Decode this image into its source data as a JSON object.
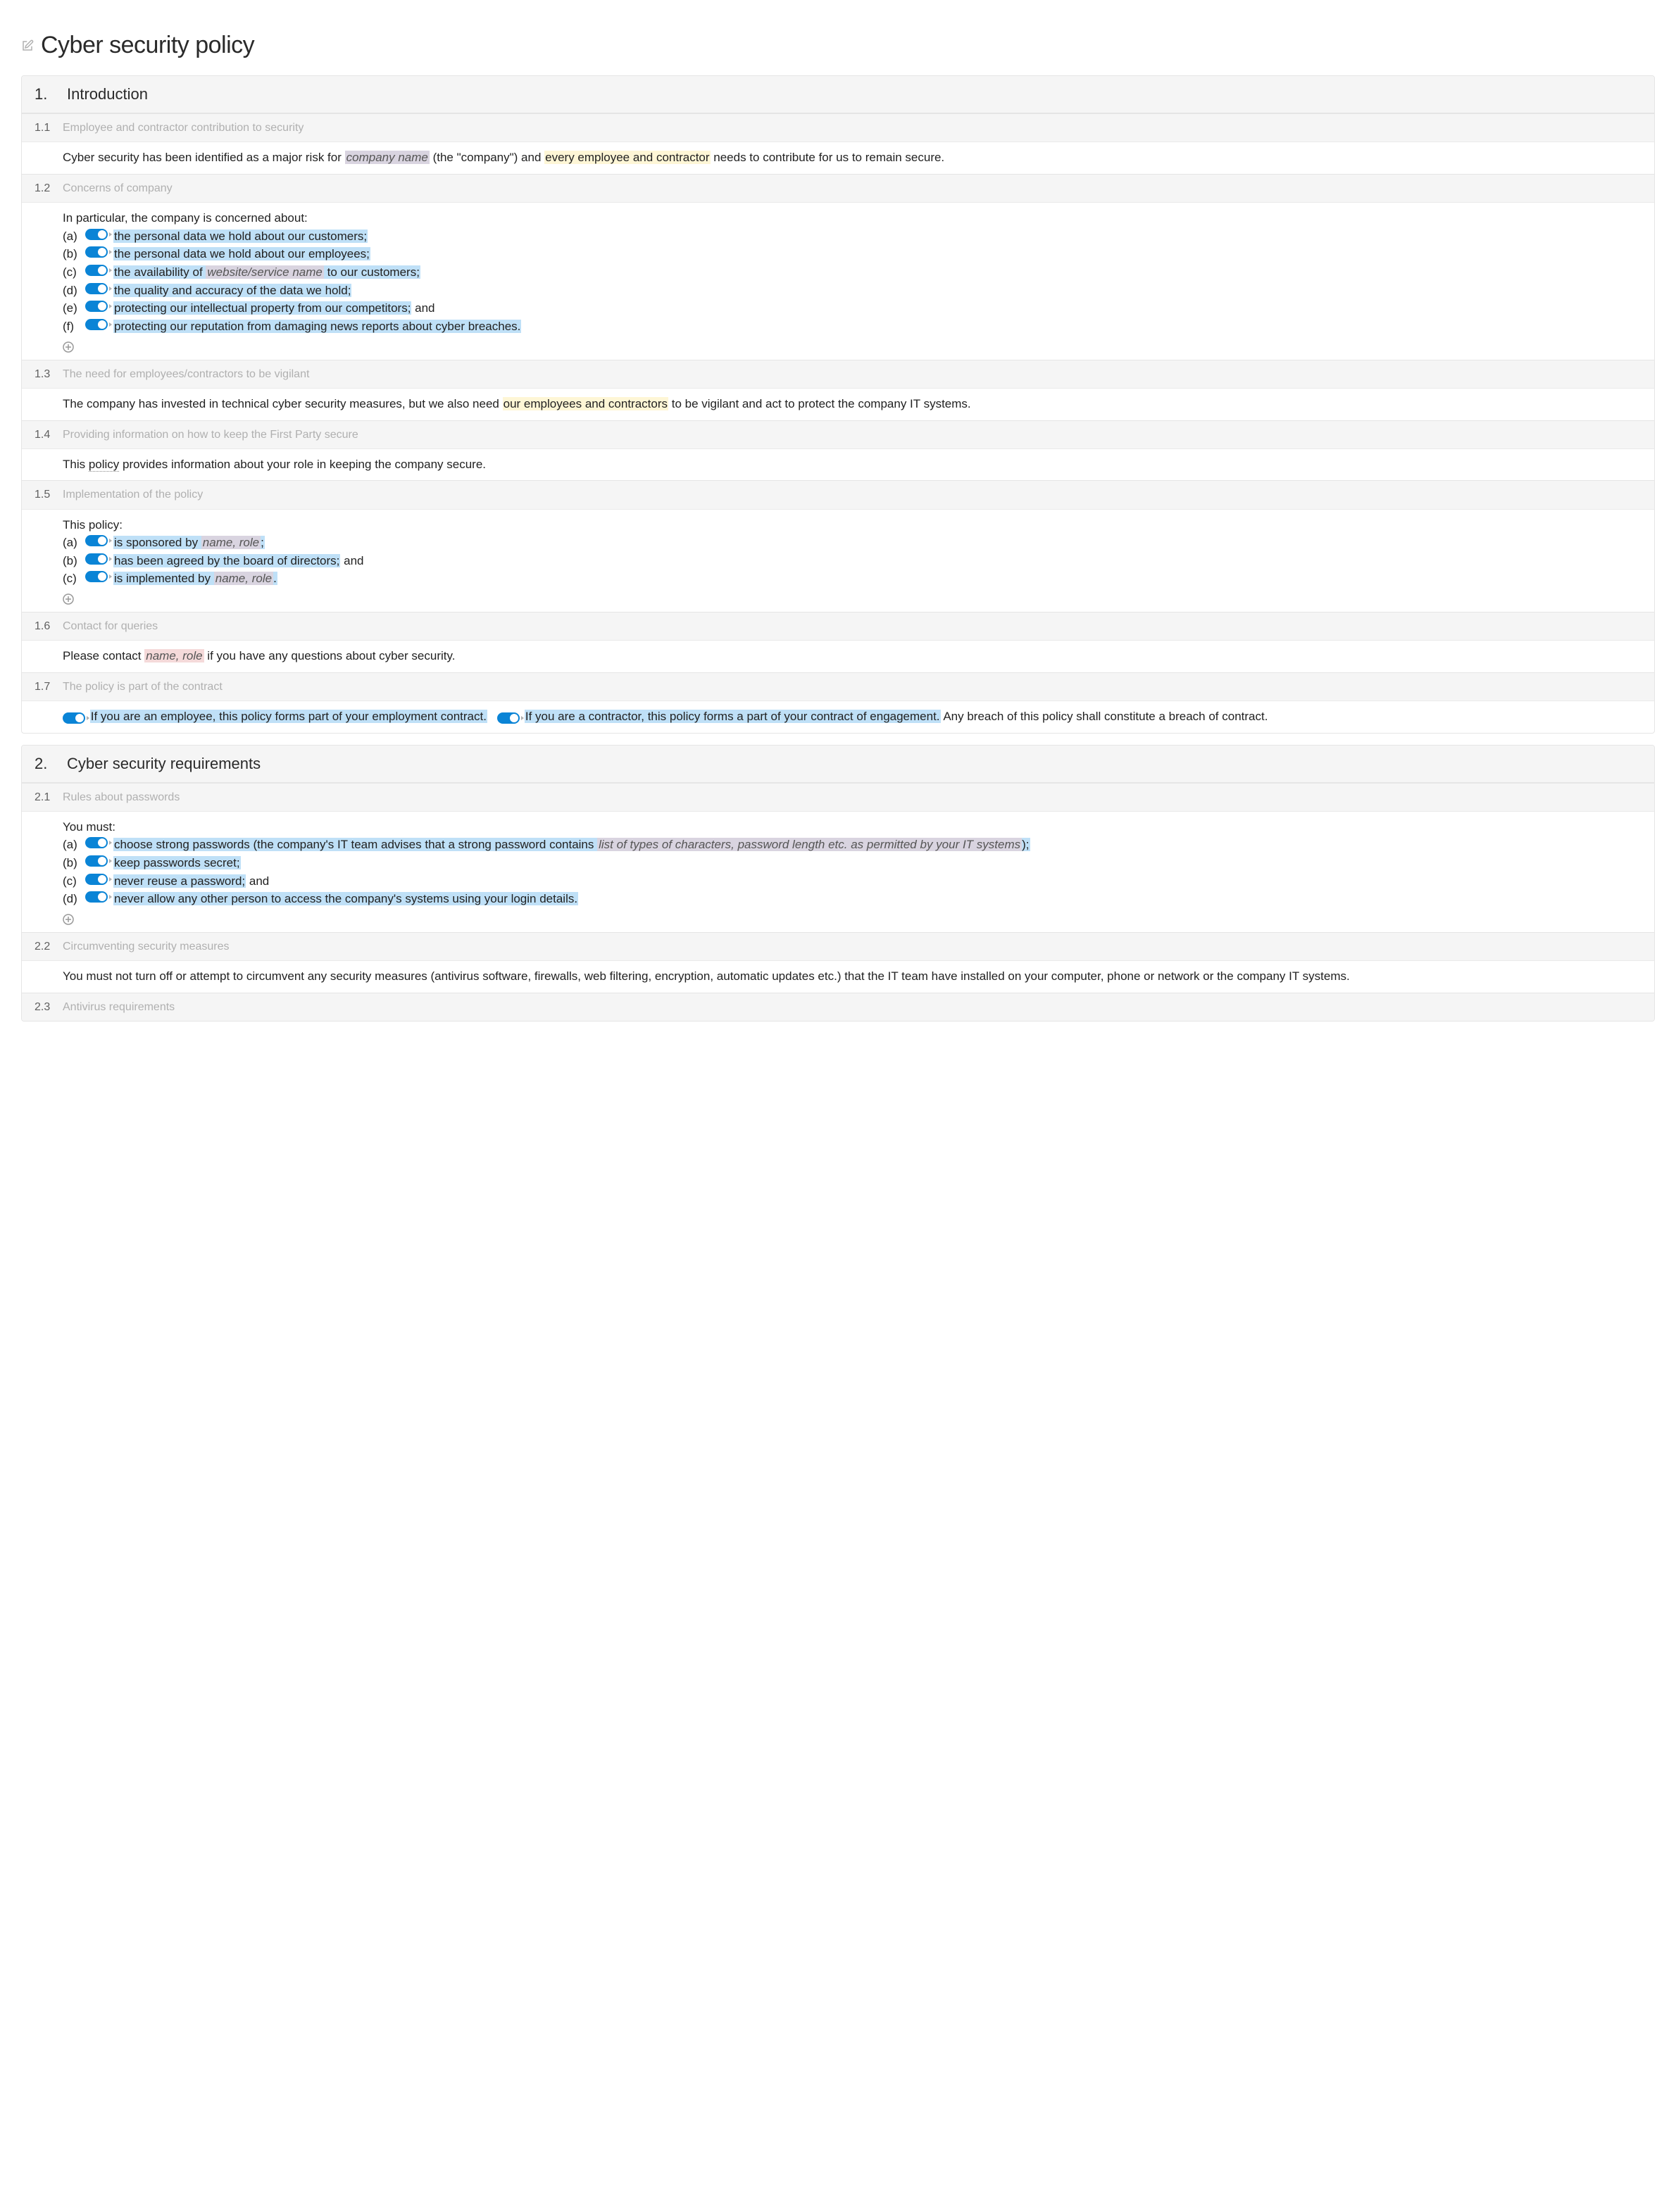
{
  "title": "Cyber security policy",
  "sections": [
    {
      "num": "1.",
      "title": "Introduction",
      "clauses": [
        {
          "num": "1.1",
          "title": "Employee and contractor contribution to security",
          "body_pre": "Cyber security has been identified as a major risk for ",
          "ph1": "company name",
          "body_mid": " (the \"company\") and ",
          "hl_yellow": "every employee and contractor",
          "body_post": " needs to contribute for us to remain secure."
        },
        {
          "num": "1.2",
          "title": "Concerns of company",
          "intro": "In particular, the company is concerned about:",
          "items": [
            {
              "label": "(a)",
              "text": "the personal data we hold about our customers;"
            },
            {
              "label": "(b)",
              "text": "the personal data we hold about our employees;"
            },
            {
              "label": "(c)",
              "pre": "the availability of ",
              "ph": "website/service name",
              "post": " to our customers;"
            },
            {
              "label": "(d)",
              "text": "the quality and accuracy of the data we hold;"
            },
            {
              "label": "(e)",
              "text_hl": "protecting our intellectual property from our competitors;",
              "tail": " and"
            },
            {
              "label": "(f)",
              "text": "protecting our reputation from damaging news reports about cyber breaches."
            }
          ]
        },
        {
          "num": "1.3",
          "title": "The need for employees/contractors to be vigilant",
          "body_pre": "The company has invested in technical cyber security measures, but we also need ",
          "hl_yellow": "our employees and contractors",
          "body_post": " to be vigilant and act to protect the company IT systems."
        },
        {
          "num": "1.4",
          "title": "Providing information on how to keep the First Party secure",
          "body_pre": "This ",
          "dotted": "policy",
          "body_post": " provides information about your role in keeping the company secure."
        },
        {
          "num": "1.5",
          "title": "Implementation of the policy",
          "intro": "This policy:",
          "items": [
            {
              "label": "(a)",
              "pre": "is sponsored by ",
              "ph": "name, role",
              "post": ";"
            },
            {
              "label": "(b)",
              "text_hl": "has been agreed by the board of directors;",
              "tail": " and"
            },
            {
              "label": "(c)",
              "pre": "is implemented by ",
              "ph": "name, role",
              "post": "."
            }
          ]
        },
        {
          "num": "1.6",
          "title": "Contact for queries",
          "body_pre": "Please contact ",
          "ph_pink": "name, role",
          "body_post": " if you have any questions about cyber security."
        },
        {
          "num": "1.7",
          "title": "The policy is part of the contract",
          "seg1": "If you are an employee, this policy forms part of your employment contract.",
          "seg2_hl": "If you are a contractor, this policy forms a part of your contract of engagement.",
          "tail": " Any breach of this policy shall constitute a breach of contract."
        }
      ]
    },
    {
      "num": "2.",
      "title": "Cyber security requirements",
      "clauses": [
        {
          "num": "2.1",
          "title": "Rules about passwords",
          "intro": "You must:",
          "items": [
            {
              "label": "(a)",
              "pre": "choose strong passwords (the company's IT team advises that a strong password contains ",
              "ph": "list of types of characters, password length etc. as permitted by your IT systems",
              "post": ");"
            },
            {
              "label": "(b)",
              "text": "keep passwords secret;"
            },
            {
              "label": "(c)",
              "text_hl": "never reuse a password;",
              "tail": " and"
            },
            {
              "label": "(d)",
              "text": "never allow any other person to access the company's systems using your login details."
            }
          ]
        },
        {
          "num": "2.2",
          "title": "Circumventing security measures",
          "body_plain": "You must not turn off or attempt to circumvent any security measures (antivirus software, firewalls, web filtering, encryption, automatic updates etc.) that the IT team have installed on your computer, phone or network or the company IT systems."
        },
        {
          "num": "2.3",
          "title": "Antivirus requirements"
        }
      ]
    }
  ]
}
